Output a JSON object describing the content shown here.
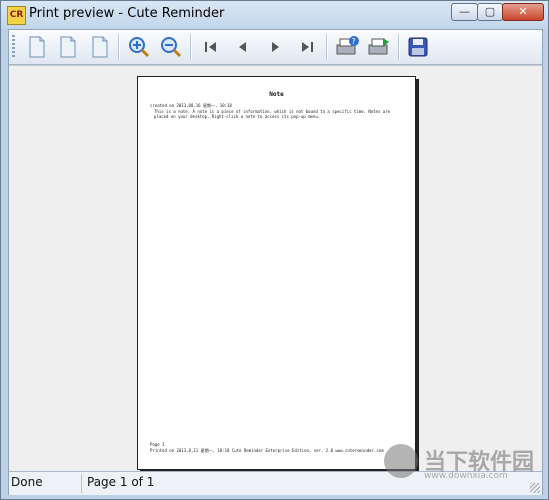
{
  "window": {
    "title": "Print preview - Cute Reminder",
    "app_badge": "CR",
    "controls": {
      "minimize": "—",
      "maximize": "▢",
      "close": "✕"
    }
  },
  "toolbar": {
    "icons": [
      "page-icon",
      "page-icon",
      "page-icon",
      "zoom-in-icon",
      "zoom-out-icon",
      "first-page-icon",
      "prev-page-icon",
      "next-page-icon",
      "last-page-icon",
      "printer-help-icon",
      "printer-setup-icon",
      "save-icon"
    ]
  },
  "preview": {
    "page": {
      "title": "Note",
      "line1": "created on 2013,08,16 星期一, 10:18",
      "line2": "This is a note. A note is a piece of information, which is not bound to a specific time. Notes are",
      "line3": "placed on your desktop. Right-click a note to access its pop-up menu.",
      "footer1": "Page 1",
      "footer2": "Printed on 2013,8,11 星期一, 18:18     Cute Reminder Enterprise Edition, ver. 2.0    www.cutereminder.com"
    }
  },
  "status": {
    "state": "Done",
    "page_info": "Page 1 of 1"
  },
  "watermark": {
    "text": "当下软件园",
    "url": "www.downxia.com"
  },
  "colors": {
    "accent": "#2f6fd0",
    "save": "#3a56b8"
  }
}
